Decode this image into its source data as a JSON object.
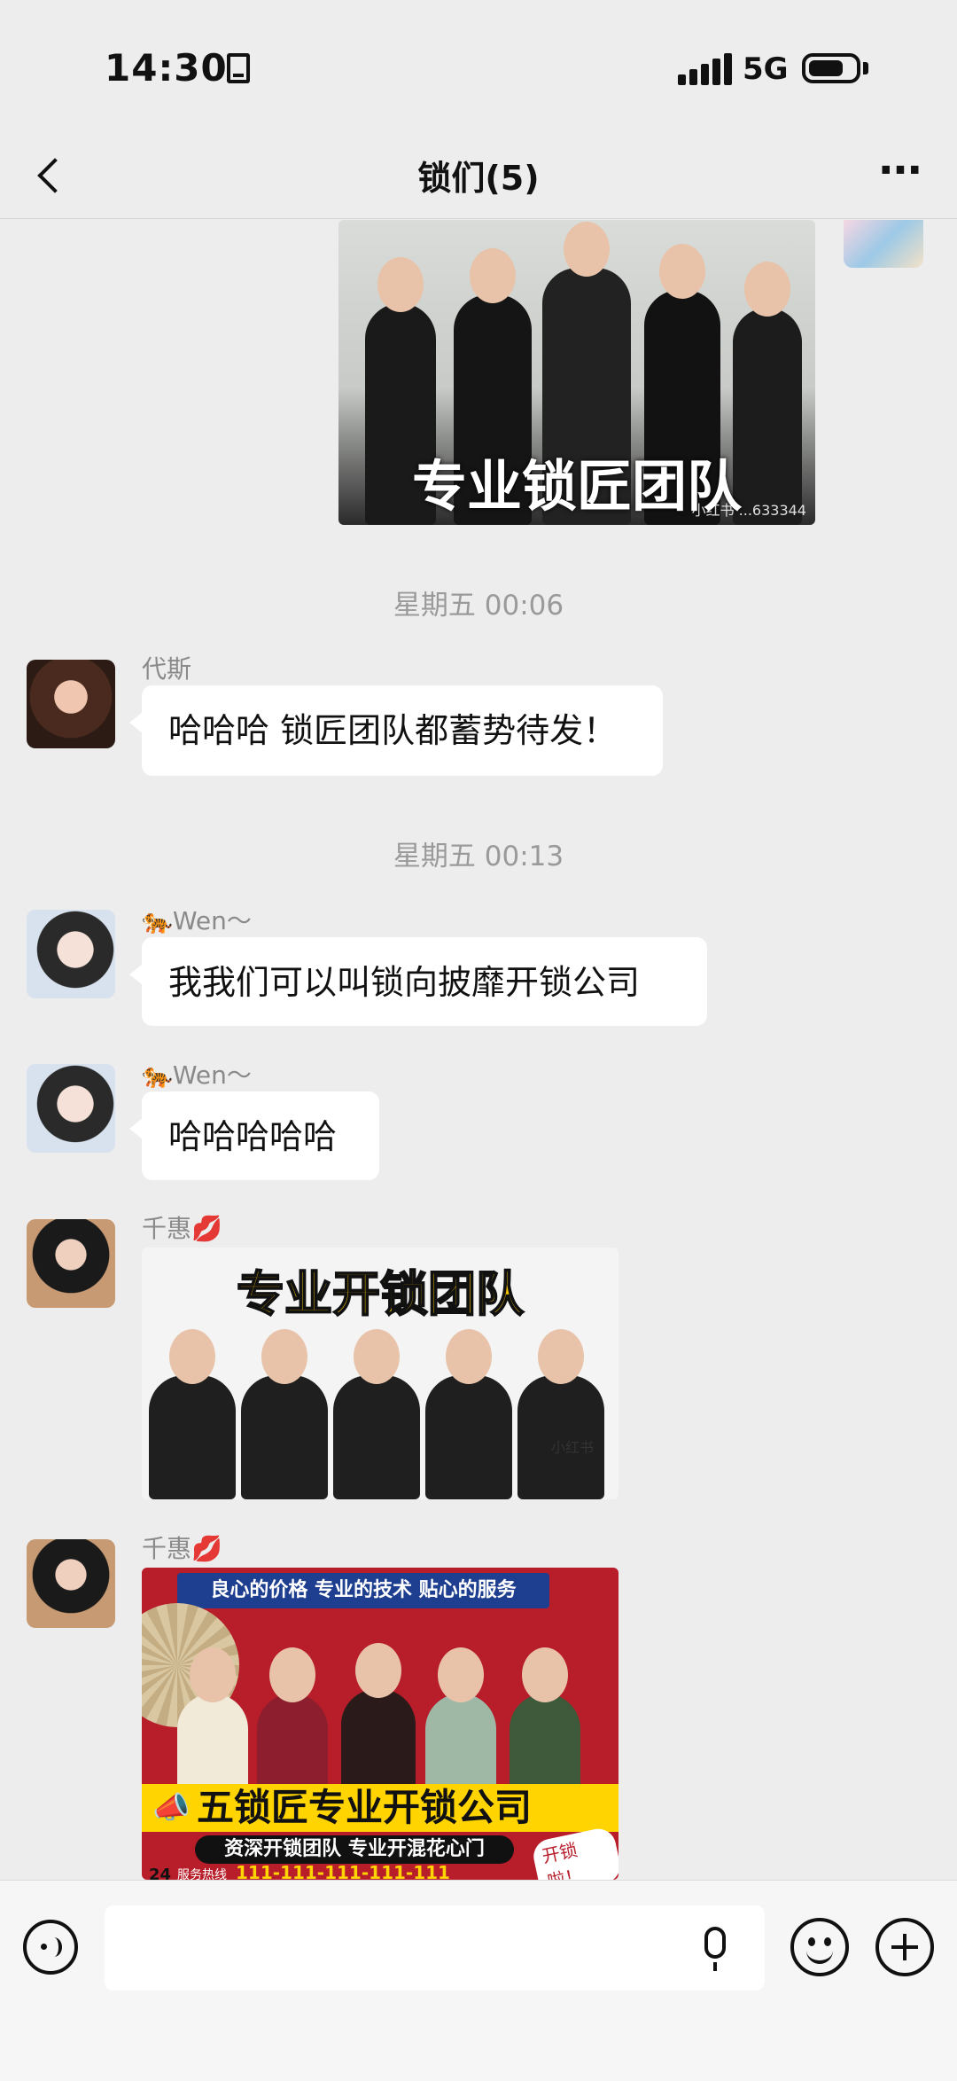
{
  "status_bar": {
    "time": "14:30",
    "network": "5G"
  },
  "header": {
    "title": "锁们(5)",
    "more": "···"
  },
  "messages": [
    {
      "type": "image",
      "direction": "outgoing",
      "caption": "专业锁匠团队",
      "watermark": "小红书 ...633344"
    },
    {
      "type": "timestamp",
      "text": "星期五 00:06"
    },
    {
      "type": "text",
      "sender": "代斯",
      "text": "哈哈哈 锁匠团队都蓄势待发！"
    },
    {
      "type": "timestamp",
      "text": "星期五 00:13"
    },
    {
      "type": "text",
      "sender": "🐅Wen～",
      "text": "我我们可以叫锁向披靡开锁公司"
    },
    {
      "type": "text",
      "sender": "🐅Wen～",
      "text": "哈哈哈哈哈"
    },
    {
      "type": "image",
      "sender": "千惠💋",
      "caption": "专业开锁团队",
      "watermark": "小红书"
    },
    {
      "type": "image",
      "sender": "千惠💋",
      "banner_top": "良心的价格 专业的技术 贴心的服务",
      "company": "五锁匠专业开锁公司",
      "slogan": "资深开锁团队 专业开混花心门",
      "phone_label": "服务热线",
      "phone": "111-111-111-111-111",
      "badge": "24",
      "sticker": "开锁啦！"
    }
  ],
  "input_bar": {
    "placeholder": ""
  },
  "colors": {
    "background": "#ededed",
    "bubble": "#ffffff",
    "banner_red": "#b81d2a",
    "banner_yellow": "#ffd400"
  }
}
